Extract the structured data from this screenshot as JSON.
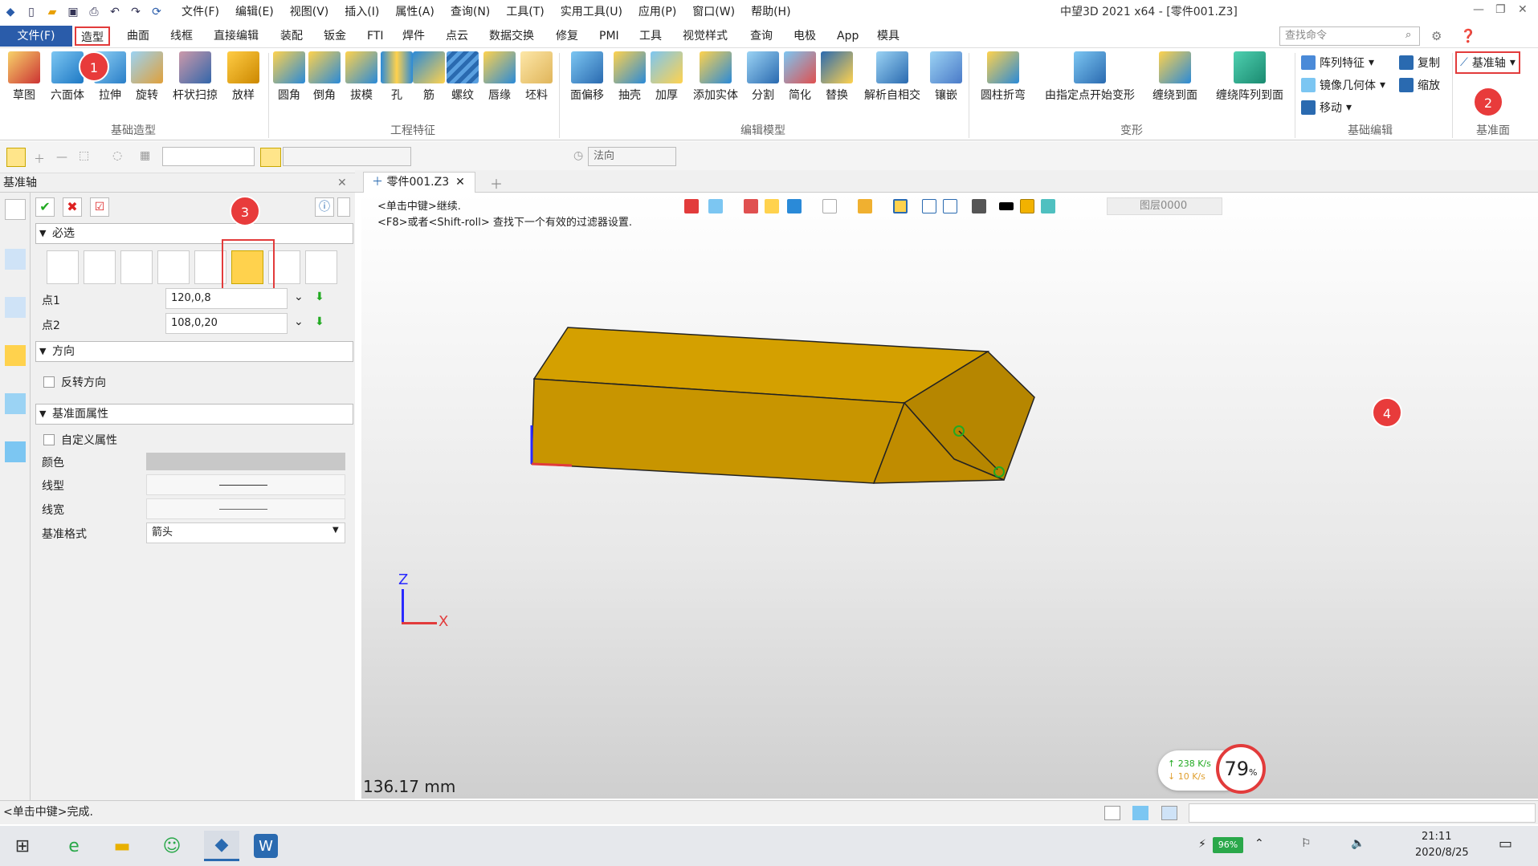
{
  "title_bar": {
    "window_title": "中望3D 2021 x64 - [零件001.Z3]",
    "menus": [
      "文件(F)",
      "编辑(E)",
      "视图(V)",
      "插入(I)",
      "属性(A)",
      "查询(N)",
      "工具(T)",
      "实用工具(U)",
      "应用(P)",
      "窗口(W)",
      "帮助(H)"
    ]
  },
  "ribbon_tabs": [
    "文件(F)",
    "造型",
    "曲面",
    "线框",
    "直接编辑",
    "装配",
    "钣金",
    "FTI",
    "焊件",
    "点云",
    "数据交换",
    "修复",
    "PMI",
    "工具",
    "视觉样式",
    "查询",
    "电极",
    "App",
    "模具"
  ],
  "search": {
    "placeholder": "查找命令"
  },
  "ribbon": {
    "basic_shape": {
      "group": "基础造型",
      "buttons": [
        "草图",
        "六面体",
        "拉伸",
        "旋转",
        "杆状扫掠",
        "放样"
      ]
    },
    "engineering": {
      "group": "工程特征",
      "buttons": [
        "圆角",
        "倒角",
        "拔模",
        "孔",
        "筋",
        "螺纹",
        "唇缘",
        "坯料"
      ]
    },
    "edit_model": {
      "group": "编辑模型",
      "buttons": [
        "面偏移",
        "抽壳",
        "加厚",
        "添加实体",
        "分割",
        "简化",
        "替换",
        "解析自相交",
        "镶嵌"
      ]
    },
    "deform": {
      "group": "变形",
      "buttons": [
        "圆柱折弯",
        "由指定点开始变形",
        "缠绕到面",
        "缠绕阵列到面"
      ]
    },
    "basic_edit": {
      "group": "基础编辑",
      "items": [
        "阵列特征",
        "复制",
        "镜像几何体",
        "缩放",
        "移动"
      ]
    },
    "datum": {
      "group": "基准面",
      "button": "基准轴"
    }
  },
  "toolbar2": {
    "filter_label": "法向"
  },
  "panel": {
    "title": "基准轴",
    "sections": {
      "required": "必选",
      "direction": "方向",
      "attributes": "基准面属性"
    },
    "point1_label": "点1",
    "point1_value": "120,0,8",
    "point2_label": "点2",
    "point2_value": "108,0,20",
    "reverse_direction": "反转方向",
    "custom_attr": "自定义属性",
    "color_label": "颜色",
    "linetype_label": "线型",
    "linewidth_label": "线宽",
    "datum_format_label": "基准格式",
    "datum_format_value": "箭头"
  },
  "document": {
    "tab": "零件001.Z3"
  },
  "viewport": {
    "hint1": "<单击中键>继续.",
    "hint2": "<F8>或者<Shift-roll> 查找下一个有效的过滤器设置.",
    "layer": "图层0000",
    "scale_text": "136.17 mm",
    "axis_x": "X",
    "axis_z": "Z",
    "net_up": "238 K/s",
    "net_down": "10  K/s",
    "cpu_percent": "79",
    "cpu_unit": "%"
  },
  "status": {
    "message": "<单击中键>完成."
  },
  "taskbar": {
    "battery": "96%",
    "time": "21:11",
    "date": "2020/8/25"
  },
  "annotations": [
    "1",
    "2",
    "3",
    "4"
  ],
  "colors": {
    "accent": "#2a5caa",
    "part_face": "#cc9900",
    "marker": "#e23b3b"
  }
}
